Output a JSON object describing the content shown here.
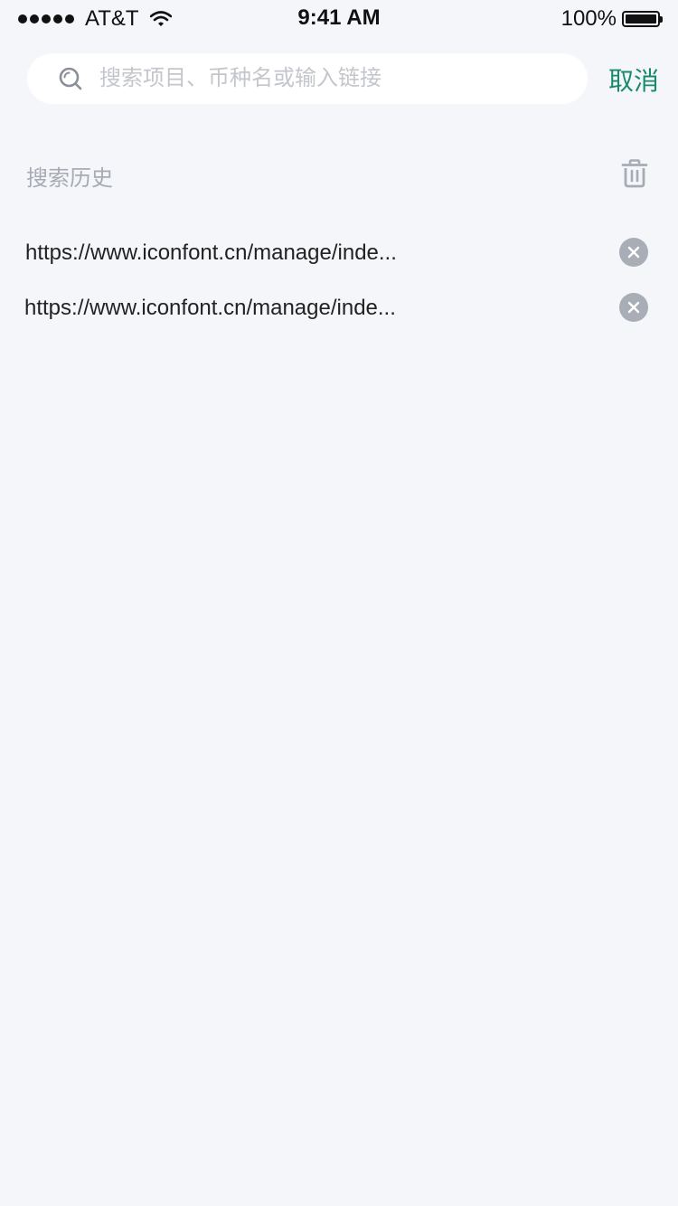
{
  "status_bar": {
    "carrier": "AT&T",
    "time": "9:41 AM",
    "battery": "100%",
    "wifi_icon": "wifi-icon",
    "battery_icon": "battery-icon"
  },
  "search": {
    "placeholder": "搜索项目、币种名或输入链接",
    "value": "",
    "icon": "search-icon",
    "cancel_label": "取消"
  },
  "history": {
    "title": "搜索历史",
    "clear_icon": "trash-icon",
    "items": [
      {
        "text": "https://www.iconfont.cn/manage/inde...",
        "remove_icon": "close-icon"
      },
      {
        "text": "https://www.iconfont.cn/manage/inde...",
        "remove_icon": "close-icon"
      }
    ]
  },
  "colors": {
    "background": "#f5f6fa",
    "accent": "#178a6c",
    "muted": "#a7abb3",
    "placeholder": "#c4c6cc",
    "remove_badge": "#a8adb6"
  }
}
